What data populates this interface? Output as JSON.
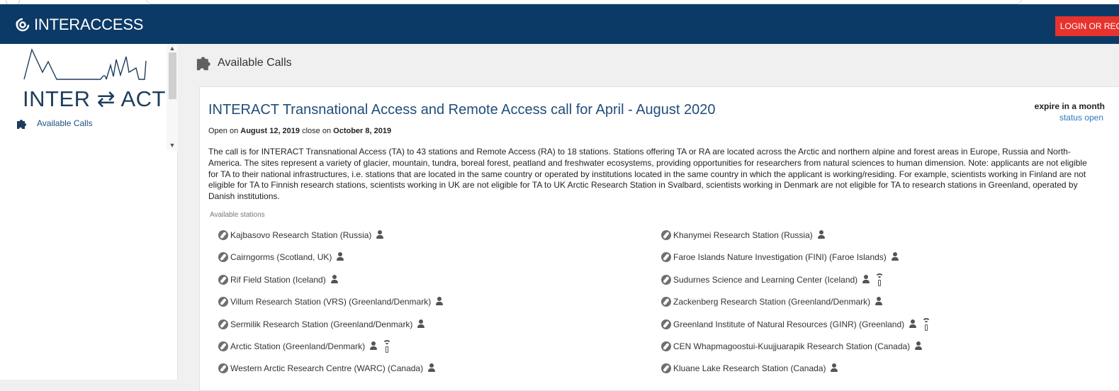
{
  "brand": {
    "name": "INTERACCESS"
  },
  "header": {
    "login_label": "LOGIN OR REGI"
  },
  "sidebar": {
    "logo_text": "INTER ⇄ ACT",
    "items": [
      {
        "label": "Available Calls",
        "icon": "puzzle-icon"
      }
    ]
  },
  "page": {
    "title": "Available Calls",
    "icon": "puzzle-icon"
  },
  "call": {
    "title": "INTERACT Transnational Access and Remote Access call for April - August 2020",
    "expire": "expire in a month",
    "status": "status open",
    "open_prefix": "Open on",
    "open_date": "August 12, 2019",
    "close_prefix": "close on",
    "close_date": "October 8, 2019",
    "description": "The call is for INTERACT Transnational Access (TA) to 43 stations and Remote Access (RA) to 18 stations. Stations offering TA or RA are located across the Arctic and northern alpine and forest areas in Europe, Russia and North-America. The sites represent a variety of glacier, mountain, tundra, boreal forest, peatland and freshwater ecosystems, providing opportunities for researchers from natural sciences to human dimension. Note: applicants are not eligible for TA to their national infrastructures, i.e. stations that are located in the same country or operated by institutions located in the same country in which the applicant is working/residing. For example, scientists working in Finland are not eligible for TA to Finnish research stations, scientists working in UK are not eligible for TA to UK Arctic Research Station in Svalbard, scientists working in Denmark are not eligible for TA to research stations in Greenland, operated by Danish institutions.",
    "stations_label": "Available stations",
    "stations": [
      {
        "name": "Kajbasovo Research Station (Russia)",
        "remote": false
      },
      {
        "name": "Khanymei Research Station (Russia)",
        "remote": false
      },
      {
        "name": "Cairngorms (Scotland, UK)",
        "remote": false
      },
      {
        "name": "Faroe Islands Nature Investigation (FINI) (Faroe Islands)",
        "remote": false
      },
      {
        "name": "Rif Field Station (Iceland)",
        "remote": false
      },
      {
        "name": "Sudurnes Science and Learning Center (Iceland)",
        "remote": true
      },
      {
        "name": "Villum Research Station (VRS) (Greenland/Denmark)",
        "remote": false
      },
      {
        "name": "Zackenberg Research Station (Greenland/Denmark)",
        "remote": false
      },
      {
        "name": "Sermilik Research Station (Greenland/Denmark)",
        "remote": false
      },
      {
        "name": "Greenland Institute of Natural Resources (GINR) (Greenland)",
        "remote": true
      },
      {
        "name": "Arctic Station (Greenland/Denmark)",
        "remote": true
      },
      {
        "name": "CEN Whapmagoostui-Kuujjuarapik Research Station (Canada)",
        "remote": false
      },
      {
        "name": "Western Arctic Research Centre (WARC) (Canada)",
        "remote": false
      },
      {
        "name": "Kluane Lake Research Station (Canada)",
        "remote": false
      }
    ]
  },
  "colors": {
    "topbar": "#0c3a66",
    "login": "#e8322d",
    "link": "#1f4e79"
  }
}
